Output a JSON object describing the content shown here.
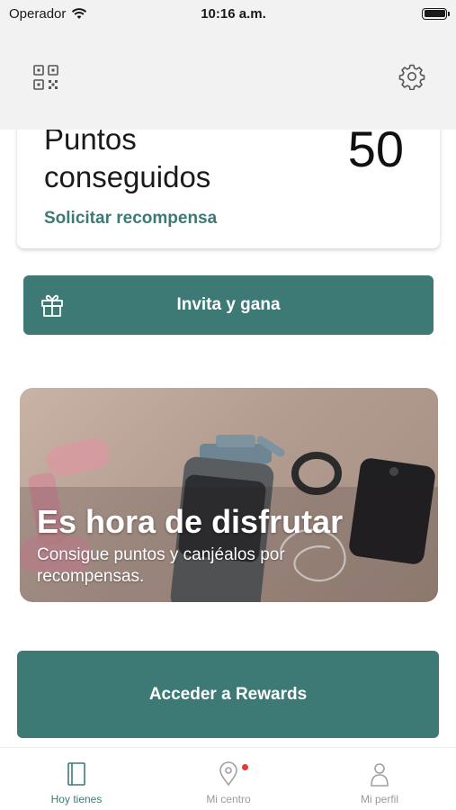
{
  "status_bar": {
    "carrier": "Operador",
    "time": "10:16 a.m."
  },
  "header": {
    "qr_icon": "qr-code-icon",
    "settings_icon": "gear-icon"
  },
  "points_card": {
    "label": "Puntos conseguidos",
    "value": "50",
    "redeem_link": "Solicitar recompensa"
  },
  "invite": {
    "label": "Invita y gana",
    "icon": "gift-icon"
  },
  "banner": {
    "title": "Es hora de disfrutar",
    "subtitle": "Consigue puntos y canjéalos por recompensas."
  },
  "rewards_button": {
    "label": "Acceder a Rewards"
  },
  "tab_bar": {
    "tabs": [
      {
        "label": "Hoy tienes",
        "icon": "notebook-icon",
        "active": true
      },
      {
        "label": "Mi centro",
        "icon": "location-pin-icon",
        "active": false,
        "notification": true
      },
      {
        "label": "Mi perfil",
        "icon": "profile-icon",
        "active": false
      }
    ]
  },
  "colors": {
    "accent": "#3e7a75",
    "header_bg": "#f2f2f2",
    "notification": "#e53935"
  }
}
